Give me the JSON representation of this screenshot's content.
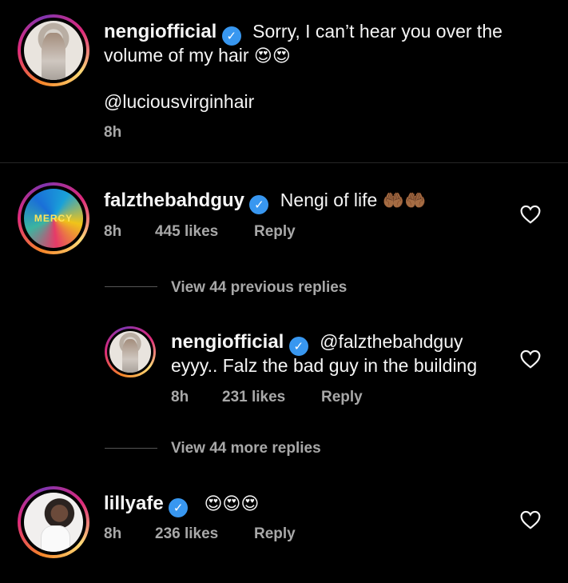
{
  "caption": {
    "username": "nengiofficial",
    "text_line1": "Sorry, I can’t hear you over the",
    "text_line2": "volume of my hair",
    "emojis": "😍😍",
    "mention": "@luciousvirginhair",
    "time": "8h"
  },
  "comments": [
    {
      "username": "falzthebahdguy",
      "text": "Nengi of life",
      "emojis": "🤲🏾🤲🏾",
      "time": "8h",
      "likes": "445 likes",
      "reply": "Reply",
      "view_replies": "View 44 previous replies",
      "replies": [
        {
          "username": "nengiofficial",
          "mention": "@falzthebahdguy",
          "text": "eyyy.. Falz the bad guy in the building",
          "time": "8h",
          "likes": "231 likes",
          "reply": "Reply"
        }
      ],
      "view_more": "View 44 more replies"
    },
    {
      "username": "lillyafe",
      "emojis": "😍😍😍",
      "time": "8h",
      "likes": "236 likes",
      "reply": "Reply"
    }
  ],
  "icons": {
    "verified": "verified-badge-icon",
    "like": "heart-outline-icon"
  },
  "colors": {
    "background": "#000000",
    "verified": "#3897f0",
    "secondary_text": "#a8a8a8"
  }
}
